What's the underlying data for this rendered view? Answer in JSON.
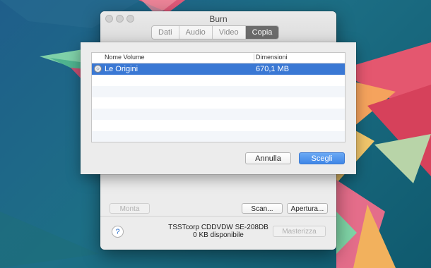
{
  "window": {
    "title": "Burn",
    "tabs": [
      {
        "label": "Dati",
        "active": false
      },
      {
        "label": "Audio",
        "active": false
      },
      {
        "label": "Video",
        "active": false
      },
      {
        "label": "Copia",
        "active": true
      }
    ],
    "buttons": {
      "mount": "Monta",
      "scan": "Scan...",
      "open": "Apertura...",
      "burn": "Masterizza"
    },
    "help_label": "?",
    "drive_name": "TSSTcorp CDDVDW SE-208DB",
    "drive_free": "0 KB disponibile"
  },
  "sheet": {
    "columns": [
      "Nome Volume",
      "Dimensioni"
    ],
    "rows": [
      {
        "name": "Le Origini",
        "size": "670,1 MB",
        "selected": true,
        "icon": "disc-icon"
      }
    ],
    "cancel_label": "Annulla",
    "choose_label": "Scegli"
  },
  "colors": {
    "selection": "#3a78d4",
    "primary_button": "#3f86e7",
    "tab_active": "#6b6b6b"
  }
}
